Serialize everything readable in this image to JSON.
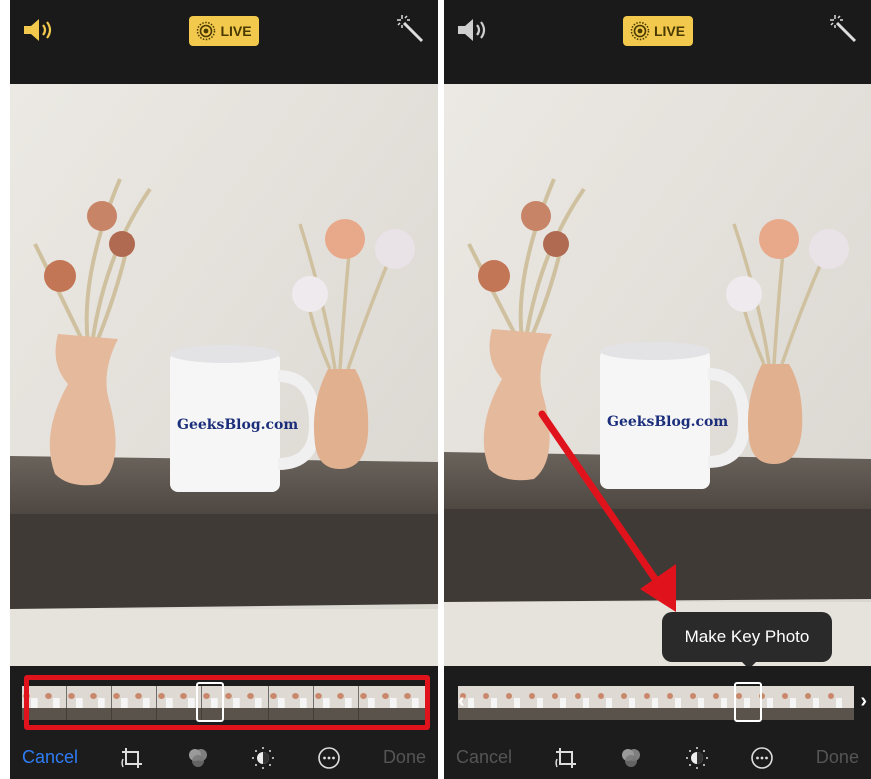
{
  "left": {
    "live_label": "LIVE",
    "toolbar": {
      "cancel_label": "Cancel",
      "done_label": "Done"
    }
  },
  "right": {
    "live_label": "LIVE",
    "tooltip_label": "Make Key Photo",
    "toolbar": {
      "cancel_label": "Cancel",
      "done_label": "Done"
    }
  },
  "colors": {
    "accent_blue": "#2e7cf6",
    "live_yellow": "#f2c94c",
    "highlight_red": "#e0131d",
    "arrow_red": "#e0131d"
  },
  "icons": [
    "speaker-icon",
    "live-icon",
    "magic-wand-icon",
    "crop-icon",
    "filters-icon",
    "adjust-icon",
    "more-icon",
    "arrow-annotation"
  ]
}
